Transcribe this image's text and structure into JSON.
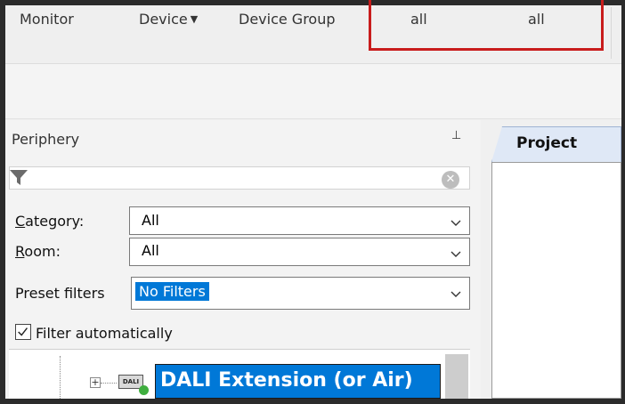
{
  "menubar": {
    "items": [
      {
        "label": "Monitor"
      },
      {
        "label": "Device"
      },
      {
        "label": "Device Group"
      }
    ],
    "highlight_values": [
      "all",
      "all"
    ]
  },
  "periphery": {
    "title": "Periphery",
    "pin_icon": "pin-icon",
    "filter_placeholder": "",
    "category": {
      "label_first": "C",
      "label_rest": "ategory:",
      "value": "All"
    },
    "room": {
      "label_first": "R",
      "label_rest": "oom:",
      "value": "All"
    },
    "preset_filters": {
      "label": "Preset filters",
      "value": "No Filters"
    },
    "filter_automatically": {
      "label": "Filter automatically",
      "checked": true
    },
    "tree": {
      "selected_item": "DALI Extension (or Air)",
      "icon_text": "DALI",
      "status_color": "#3fae3f"
    }
  },
  "project": {
    "tab_label": "Project"
  },
  "colors": {
    "accent": "#0078d7",
    "highlight_border": "#c81c1c"
  }
}
